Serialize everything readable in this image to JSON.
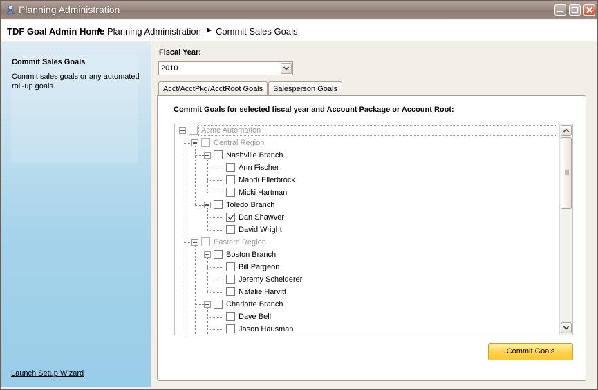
{
  "window": {
    "title": "Planning Administration",
    "controls": [
      "minimize-icon",
      "maximize-icon",
      "close-icon"
    ]
  },
  "breadcrumb": {
    "home": "TDF Goal Admin Home",
    "items": [
      "Planning Administration",
      "Commit Sales Goals"
    ]
  },
  "sidebar": {
    "title": "Commit Sales Goals",
    "description": "Commit sales goals or any automated roll-up goals.",
    "wizard_link": "Launch Setup Wizard"
  },
  "fiscal_year": {
    "label": "Fiscal Year:",
    "value": "2010"
  },
  "tabs": [
    {
      "label": "Acct/AcctPkg/AcctRoot Goals",
      "active": true
    },
    {
      "label": "Salesperson Goals",
      "active": false
    }
  ],
  "panel": {
    "heading": "Commit Goals for selected fiscal year and Account Package or Account Root:"
  },
  "tree": [
    {
      "label": "Acme Automation",
      "level": 0,
      "expander": true,
      "checked": false,
      "disabled": true
    },
    {
      "label": "Central Region",
      "level": 1,
      "expander": true,
      "checked": false,
      "disabled": true
    },
    {
      "label": "Nashville Branch",
      "level": 2,
      "expander": true,
      "checked": false,
      "disabled": false
    },
    {
      "label": "Ann Fischer",
      "level": 3,
      "expander": false,
      "checked": false,
      "disabled": false
    },
    {
      "label": "Mandi Ellerbrock",
      "level": 3,
      "expander": false,
      "checked": false,
      "disabled": false
    },
    {
      "label": "Micki Hartman",
      "level": 3,
      "expander": false,
      "checked": false,
      "disabled": false
    },
    {
      "label": "Toledo Branch",
      "level": 2,
      "expander": true,
      "checked": false,
      "disabled": false
    },
    {
      "label": "Dan Shawver",
      "level": 3,
      "expander": false,
      "checked": true,
      "disabled": false
    },
    {
      "label": "David Wright",
      "level": 3,
      "expander": false,
      "checked": false,
      "disabled": false
    },
    {
      "label": "Eastern Region",
      "level": 1,
      "expander": true,
      "checked": false,
      "disabled": true
    },
    {
      "label": "Boston Branch",
      "level": 2,
      "expander": true,
      "checked": false,
      "disabled": false
    },
    {
      "label": "Bill Pargeon",
      "level": 3,
      "expander": false,
      "checked": false,
      "disabled": false
    },
    {
      "label": "Jeremy Scheiderer",
      "level": 3,
      "expander": false,
      "checked": false,
      "disabled": false
    },
    {
      "label": "Natalie Harvitt",
      "level": 3,
      "expander": false,
      "checked": false,
      "disabled": false
    },
    {
      "label": "Charlotte Branch",
      "level": 2,
      "expander": true,
      "checked": false,
      "disabled": false
    },
    {
      "label": "Dave Bell",
      "level": 3,
      "expander": false,
      "checked": false,
      "disabled": false
    },
    {
      "label": "Jason Hausman",
      "level": 3,
      "expander": false,
      "checked": false,
      "disabled": false
    }
  ],
  "commit_button": "Commit Goals",
  "colors": {
    "titlebar": "#9a8880",
    "sidebar_gradient_end": "#99cde8",
    "commit_button": "#ffd24d",
    "disabled_text": "#9a9a9a"
  }
}
